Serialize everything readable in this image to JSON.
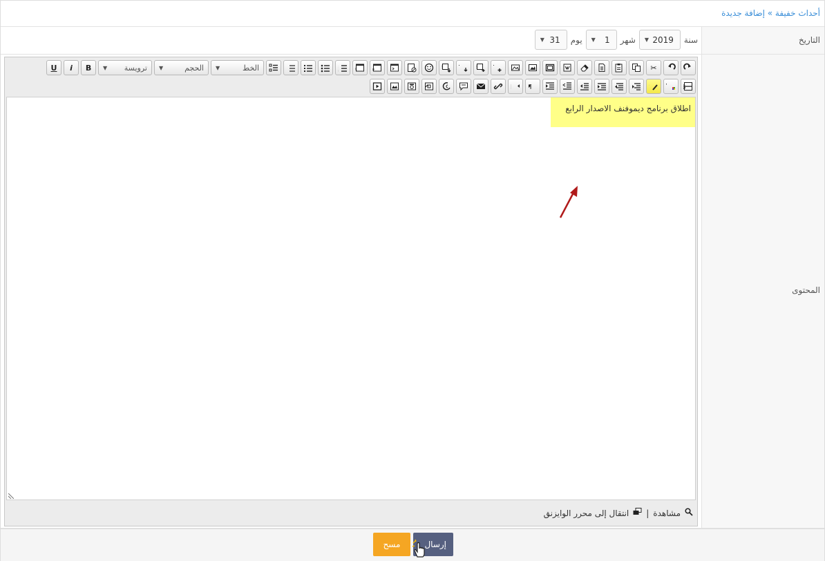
{
  "breadcrumb": {
    "parent": "أحداث خفيفة",
    "separator": " » ",
    "current": "إضافة جديدة"
  },
  "date_row": {
    "label": "التاريخ",
    "year_label": "سنة",
    "year_value": "2019",
    "month_label": "شهر",
    "month_value": "1",
    "day_label": "يوم",
    "day_value": "31"
  },
  "content_row": {
    "label": "المحتوى"
  },
  "toolbar": {
    "heading_select": "ترويسة",
    "size_select": "الحجم",
    "font_select": "الخط",
    "bold": "B",
    "italic": "i",
    "underline": "U",
    "row1_icons": [
      "redo-icon",
      "undo-icon",
      "cut-icon",
      "copy-icon",
      "paste-icon",
      "paste-text-icon",
      "eraser-icon",
      "paste-word-icon",
      "frame-icon",
      "image-frame-icon",
      "image-icon",
      "text-plus-icon",
      "bbcode-plus-icon",
      "text-down-icon",
      "bbcode-down-icon",
      "emoji-icon",
      "edit-page-icon",
      "code-window-icon",
      "php-code-icon",
      "html-code-icon",
      "ordered-list-icon",
      "unordered-list-icon",
      "bullet-list-icon",
      "list-style-icon",
      "list-settings-icon"
    ],
    "row2_icons": [
      "strikethrough-icon",
      "text-color-icon",
      "highlight-icon",
      "align-right-icon",
      "align-center-icon",
      "align-left-icon",
      "align-justify-icon",
      "indent-icon",
      "outdent-icon",
      "rtl-icon",
      "ltr-icon",
      "link-icon",
      "email-icon",
      "quote-icon",
      "unlink-icon",
      "flash-icon",
      "photo-icon",
      "gallery-icon",
      "video-icon"
    ]
  },
  "editor": {
    "content_text": "اطلاق برنامج ديموفنف الاصدار الرابع",
    "preview_label": "مشاهدة",
    "footer_separator": "|",
    "switch_label": "انتقال إلى محرر الوايزنق"
  },
  "buttons": {
    "submit": "إرسال",
    "clear": "مسح"
  },
  "colors": {
    "link": "#3a8ed8",
    "highlight": "#ffff88",
    "submit_bg": "#566080",
    "clear_bg": "#f5a623",
    "annotation_arrow": "#b01a1a"
  }
}
